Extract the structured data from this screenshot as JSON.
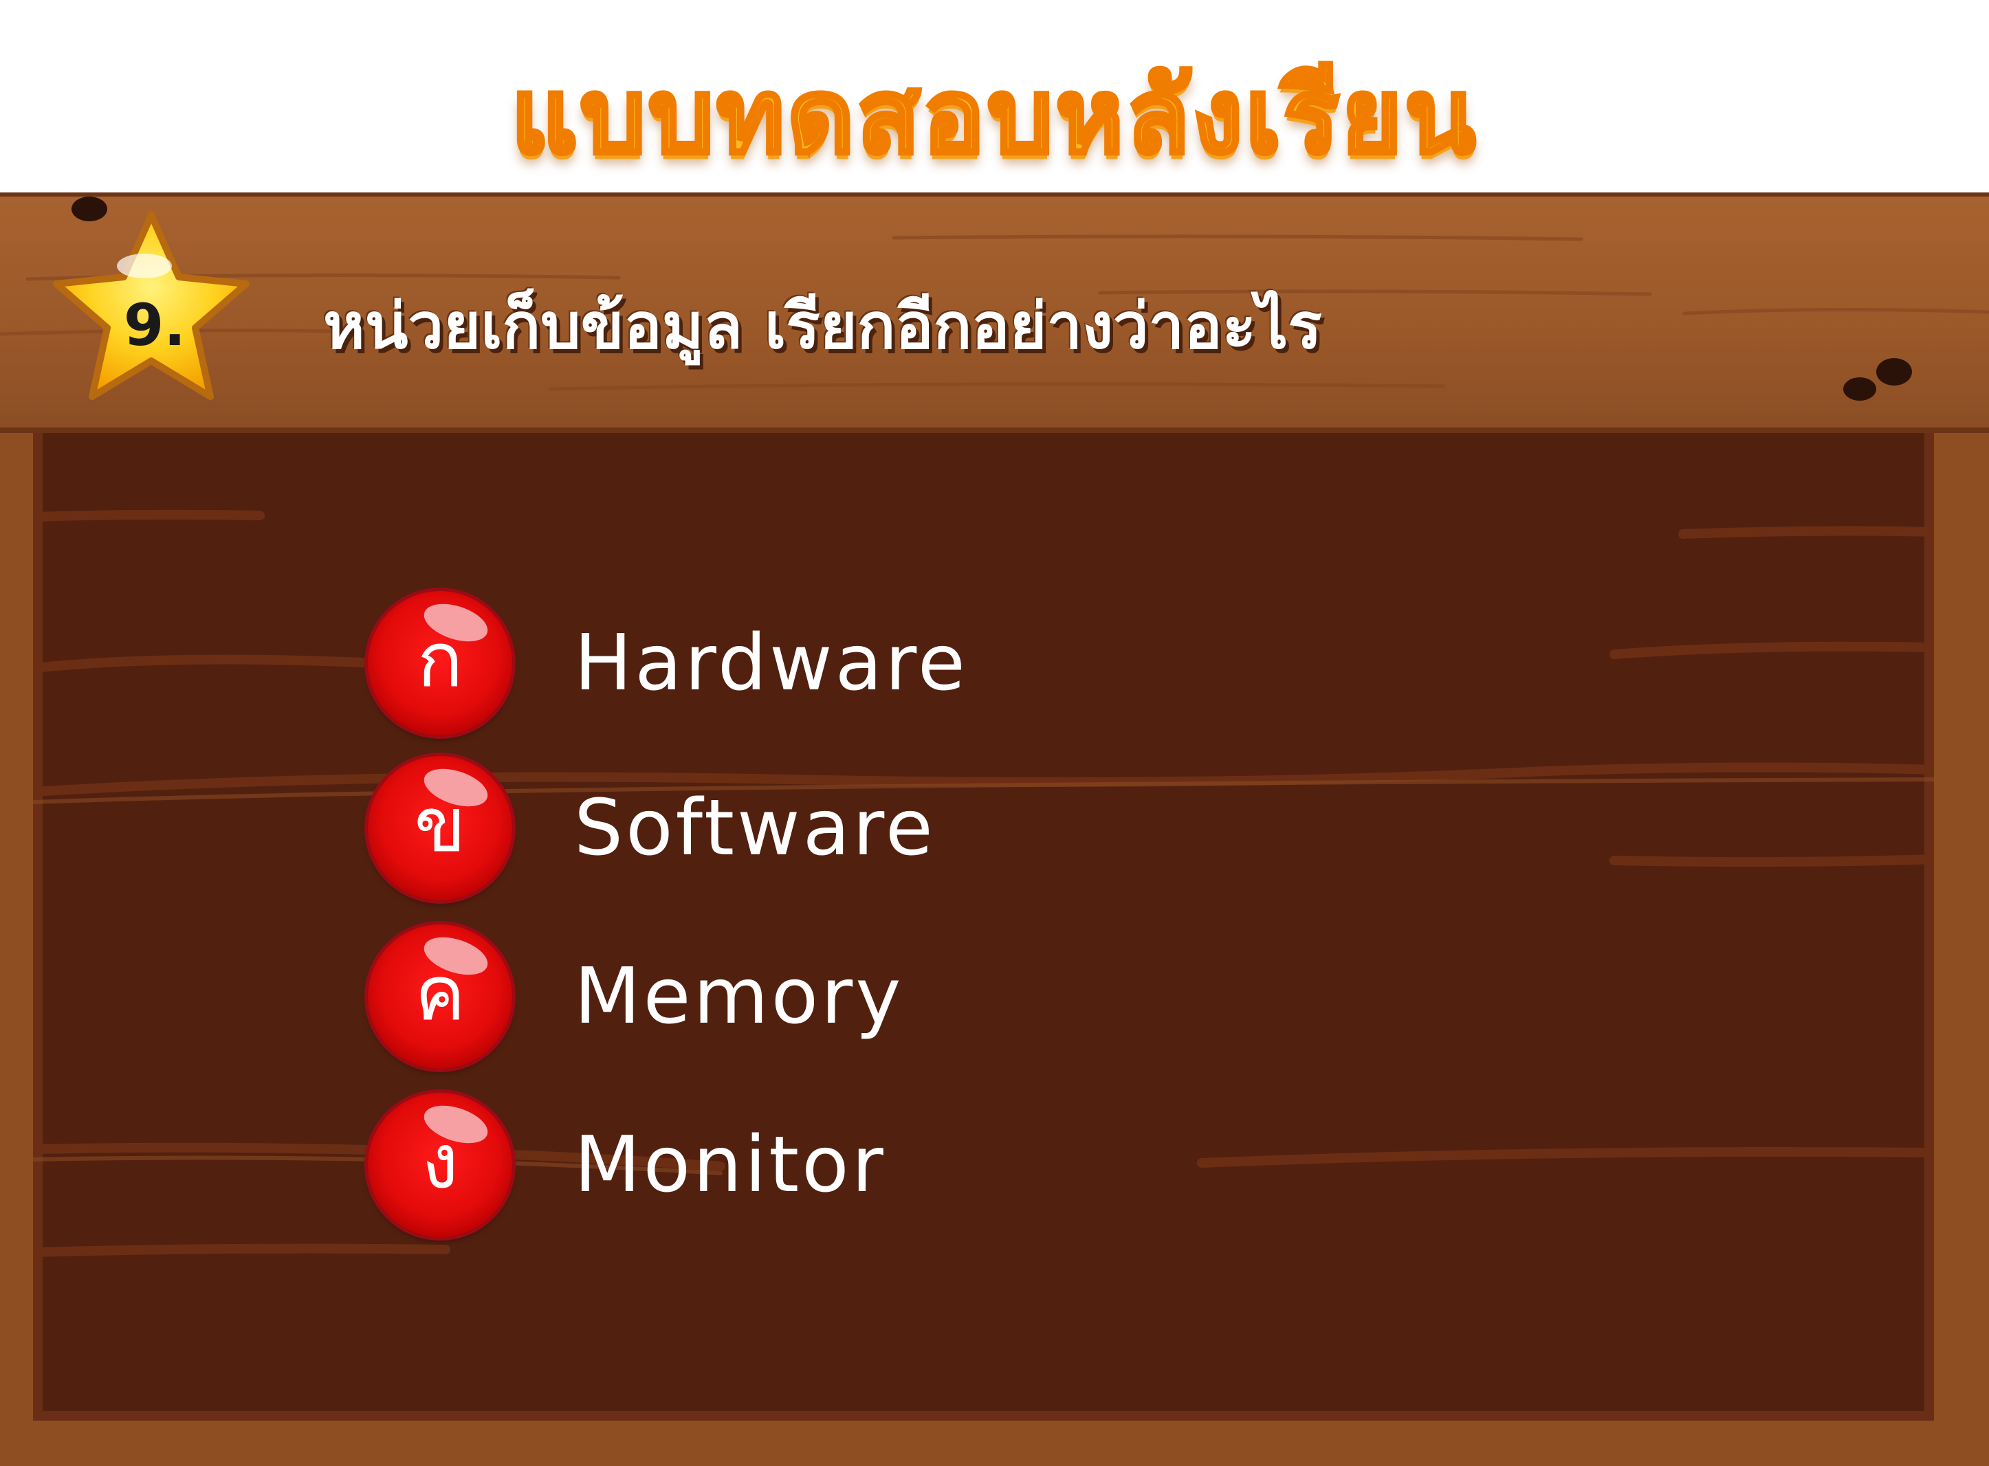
{
  "page": {
    "title": "แบบทดสอบหลังเรียน"
  },
  "question": {
    "number": "9.",
    "text": "หน่วยเก็บข้อมูล เรียกอีกอย่างว่าอะไร"
  },
  "choices": [
    {
      "letter": "ก",
      "label": "Hardware"
    },
    {
      "letter": "ข",
      "label": "Software"
    },
    {
      "letter": "ค",
      "label": "Memory"
    },
    {
      "letter": "ง",
      "label": "Monitor"
    }
  ],
  "colors": {
    "title_fill": "#ffb81e",
    "title_stroke": "#f07d00",
    "wood_frame": "#8f4e22",
    "board_dark": "#52200f",
    "bubble_red": "#e20a0a",
    "star_yellow": "#ffd21f"
  },
  "icons": {
    "question_badge": "star-icon",
    "choice_marker": "red-bubble-icon"
  }
}
